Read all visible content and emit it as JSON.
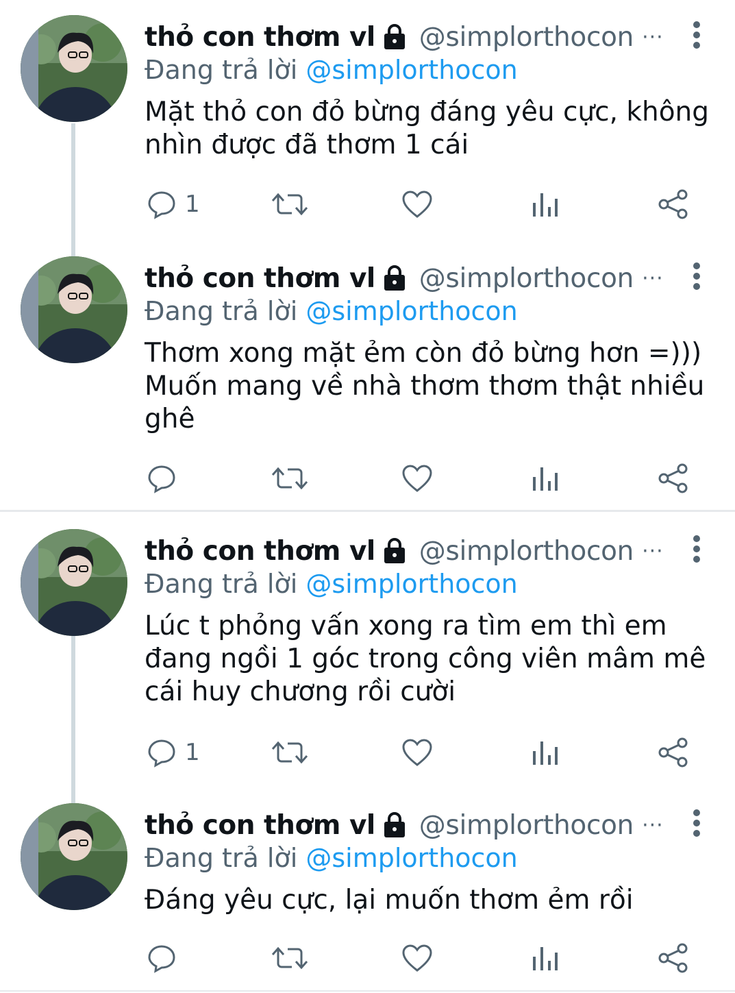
{
  "tweets": [
    {
      "name": "thỏ con thơm vl",
      "handle": "@simplorthocon",
      "dots": "···",
      "reply_prefix": "Đang trả lời",
      "reply_to": "@simplorthocon",
      "text": "Mặt thỏ con đỏ bừng đáng yêu cực, không nhìn được đã thơm 1 cái",
      "reply_count": "1"
    },
    {
      "name": "thỏ con thơm vl",
      "handle": "@simplorthocon",
      "dots": "···",
      "reply_prefix": "Đang trả lời",
      "reply_to": "@simplorthocon",
      "text": "Thơm xong mặt ẻm còn đỏ bừng hơn =))) Muốn mang về nhà thơm thơm thật nhiều ghê",
      "reply_count": ""
    },
    {
      "name": "thỏ con thơm vl",
      "handle": "@simplorthocon",
      "dots": "···",
      "reply_prefix": "Đang trả lời",
      "reply_to": "@simplorthocon",
      "text": "Lúc t phỏng vấn xong ra tìm em thì em đang ngồi 1 góc trong công viên mâm mê cái huy chương rồi cười",
      "reply_count": "1"
    },
    {
      "name": "thỏ con thơm vl",
      "handle": "@simplorthocon",
      "dots": "···",
      "reply_prefix": "Đang trả lời",
      "reply_to": "@simplorthocon",
      "text": "Đáng yêu cực, lại muốn thơm ẻm rồi",
      "reply_count": ""
    }
  ],
  "icons": {
    "lock": "lock-icon",
    "more": "more-vertical-icon",
    "reply": "reply-icon",
    "retweet": "retweet-icon",
    "like": "heart-icon",
    "views": "views-icon",
    "share": "share-icon"
  },
  "colors": {
    "text": "#0f1419",
    "secondary": "#536471",
    "mention": "#1d9bf0",
    "thread_line": "#cfd9de",
    "separator": "#e6e9ec"
  }
}
